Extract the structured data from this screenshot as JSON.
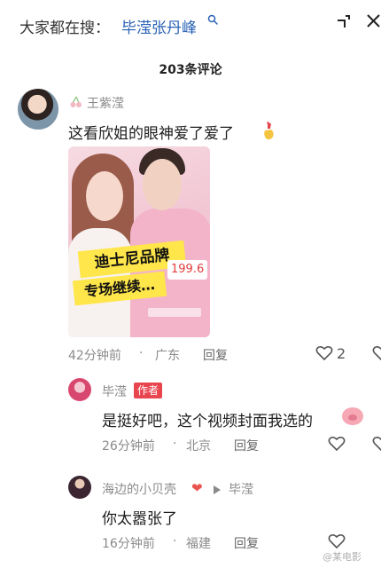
{
  "header": {
    "search_prefix": "大家都在搜：",
    "search_term": "毕滢张丹峰",
    "icons": [
      "search-icon",
      "collapse-icon",
      "close-icon"
    ]
  },
  "comments_count_title": "203条评论",
  "comment": {
    "username": "王紫滢",
    "text": "这看欣姐的眼神爱了爱了",
    "thumbnail": {
      "banner_line1": "迪士尼品牌",
      "banner_line2": "专场继续…",
      "price": "199.",
      "price_suffix": "6"
    },
    "time": "42分钟前",
    "location": "广东",
    "reply_label": "回复",
    "likes": "2"
  },
  "replies": [
    {
      "username": "毕滢",
      "badge": "作者",
      "text": "是挺好吧，这个视频封面我选的",
      "time": "26分钟前",
      "location": "北京",
      "reply_label": "回复"
    },
    {
      "username": "海边的小贝壳",
      "reply_to": "毕滢",
      "text": "你太嚣张了",
      "time": "16分钟前",
      "location": "福建",
      "reply_label": "回复"
    }
  ],
  "watermark": "@某电影",
  "colors": {
    "accent_link": "#2a62b6",
    "author_badge": "#e8454f",
    "meta_gray": "#8a8a8a"
  }
}
